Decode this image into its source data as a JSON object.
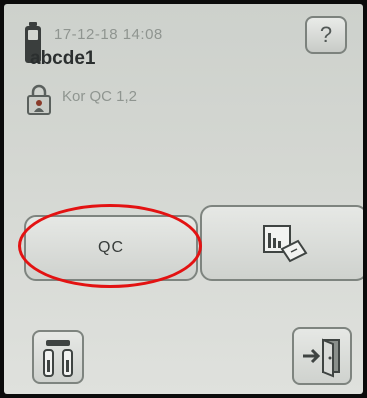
{
  "status": {
    "datetime": "17-12-18  14:08",
    "patient_id": "abcde1",
    "control_label": "Kor QC 1,2"
  },
  "buttons": {
    "help_label": "?",
    "qc_label": "QC"
  },
  "icons": {
    "battery": "battery-icon",
    "control_lock": "lock-badge-icon",
    "results": "chart-results-icon",
    "settings": "tools-settings-icon",
    "exit": "exit-door-icon"
  },
  "colors": {
    "highlight_ring": "#e31212",
    "screen_bg": "#d3d6d1"
  }
}
